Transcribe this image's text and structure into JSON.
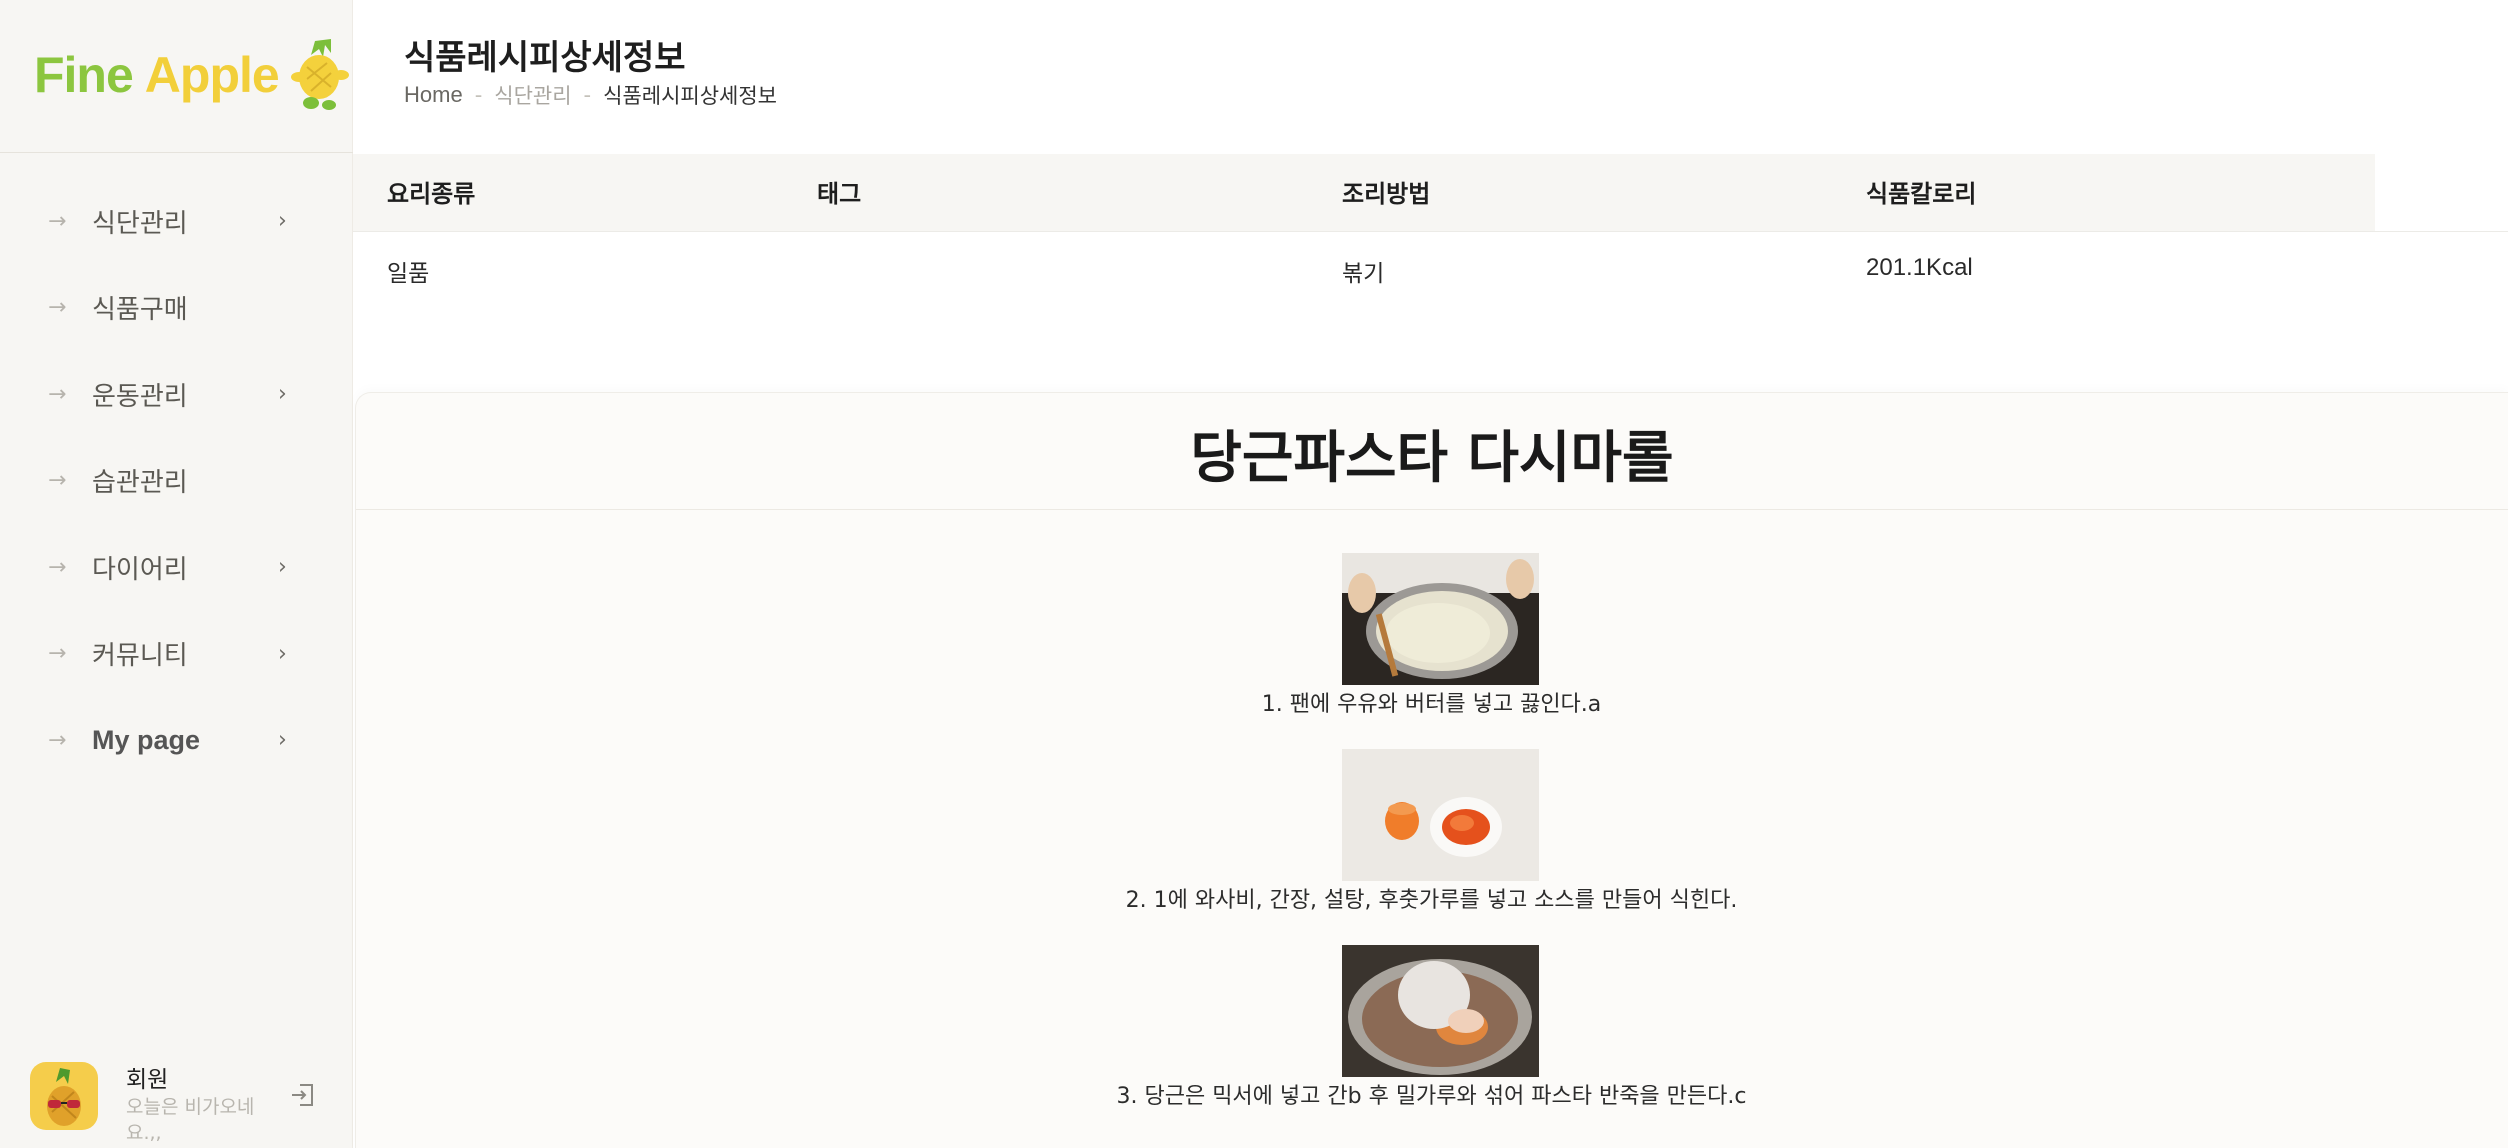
{
  "brand": {
    "name_part1": "Fine",
    "name_part2": "Apple"
  },
  "sidebar": {
    "items": [
      {
        "label": "식단관리",
        "has_submenu": true
      },
      {
        "label": "식품구매",
        "has_submenu": false
      },
      {
        "label": "운동관리",
        "has_submenu": true
      },
      {
        "label": "습관관리",
        "has_submenu": false
      },
      {
        "label": "다이어리",
        "has_submenu": true
      },
      {
        "label": "커뮤니티",
        "has_submenu": true
      },
      {
        "label": "My page",
        "has_submenu": true
      }
    ]
  },
  "profile": {
    "name": "회원",
    "message": "오늘은 비가오네요.,,"
  },
  "header": {
    "title": "식품레시피상세정보",
    "breadcrumb": [
      "Home",
      "식단관리",
      "식품레시피상세정보"
    ]
  },
  "info_table": {
    "headers": [
      "요리종류",
      "태그",
      "조리방법",
      "식품칼로리"
    ],
    "row": [
      "일품",
      "",
      "볶기",
      "201.1Kcal"
    ]
  },
  "recipe": {
    "title": "당근파스타 다시마롤",
    "steps": [
      {
        "text": "1. 팬에 우유와 버터를 넣고 끓인다.a",
        "image": "pan-milk-photo"
      },
      {
        "text": "2. 1에 와사비, 간장, 설탕, 후춧가루를 넣고 소스를 만들어 식힌다.",
        "image": "carrot-sauce-photo"
      },
      {
        "text": "3. 당근은 믹서에 넣고 간b 후 밀가루와 섞어 파스타 반죽을 만든다.c",
        "image": "dough-bowl-photo"
      }
    ]
  },
  "colors": {
    "brand_green": "#8cc63f",
    "brand_yellow": "#f2cf3a",
    "sidebar_bg": "#f7f6f3"
  }
}
